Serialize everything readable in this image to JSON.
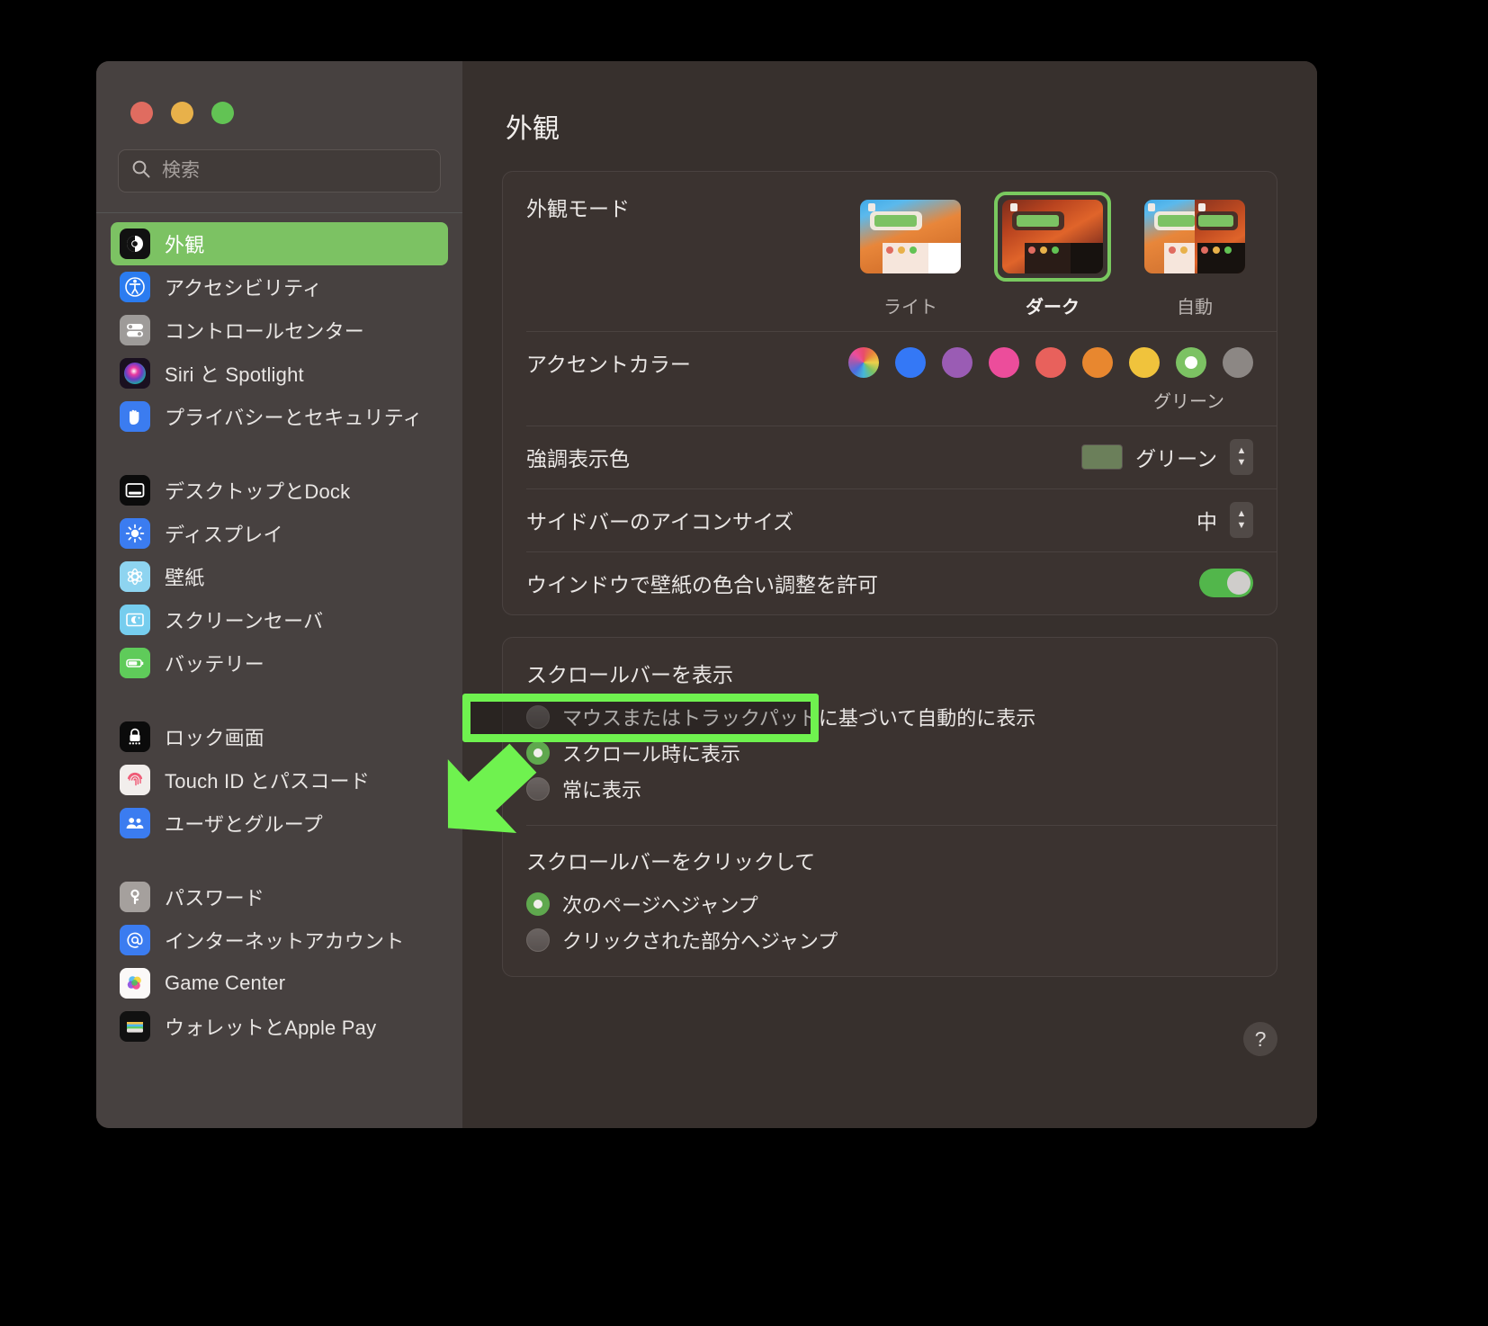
{
  "window": {
    "traffic_lights": [
      "close",
      "minimize",
      "zoom"
    ]
  },
  "sidebar": {
    "search": {
      "placeholder": "検索",
      "value": "",
      "icon": "search-icon"
    },
    "items": [
      {
        "label": "外観",
        "icon": "appearance-icon",
        "selected": true
      },
      {
        "label": "アクセシビリティ",
        "icon": "accessibility-icon",
        "selected": false
      },
      {
        "label": "コントロールセンター",
        "icon": "control-center-icon",
        "selected": false
      },
      {
        "label": "Siri と Spotlight",
        "icon": "siri-icon",
        "selected": false
      },
      {
        "label": "プライバシーとセキュリティ",
        "icon": "privacy-icon",
        "selected": false
      },
      {
        "label": "デスクトップとDock",
        "icon": "desktop-dock-icon",
        "selected": false
      },
      {
        "label": "ディスプレイ",
        "icon": "display-icon",
        "selected": false
      },
      {
        "label": "壁紙",
        "icon": "wallpaper-icon",
        "selected": false
      },
      {
        "label": "スクリーンセーバ",
        "icon": "screensaver-icon",
        "selected": false
      },
      {
        "label": "バッテリー",
        "icon": "battery-icon",
        "selected": false
      },
      {
        "label": "ロック画面",
        "icon": "lock-screen-icon",
        "selected": false
      },
      {
        "label": "Touch ID とパスコード",
        "icon": "touch-id-icon",
        "selected": false
      },
      {
        "label": "ユーザとグループ",
        "icon": "users-groups-icon",
        "selected": false
      },
      {
        "label": "パスワード",
        "icon": "passwords-icon",
        "selected": false
      },
      {
        "label": "インターネットアカウント",
        "icon": "internet-accounts-icon",
        "selected": false
      },
      {
        "label": "Game Center",
        "icon": "game-center-icon",
        "selected": false
      },
      {
        "label": "ウォレットとApple Pay",
        "icon": "wallet-icon",
        "selected": false
      }
    ]
  },
  "main": {
    "title": "外観",
    "appearance_mode": {
      "label": "外観モード",
      "options": [
        {
          "label": "ライト",
          "selected": false
        },
        {
          "label": "ダーク",
          "selected": true
        },
        {
          "label": "自動",
          "selected": false
        }
      ]
    },
    "accent_color": {
      "label": "アクセントカラー",
      "selected_name": "グリーン",
      "swatches": [
        {
          "name": "multicolor",
          "color": "multicolor",
          "selected": false
        },
        {
          "name": "blue",
          "color": "#3478f6",
          "selected": false
        },
        {
          "name": "purple",
          "color": "#9a5cb4",
          "selected": false
        },
        {
          "name": "pink",
          "color": "#ec4d9b",
          "selected": false
        },
        {
          "name": "red",
          "color": "#e8615c",
          "selected": false
        },
        {
          "name": "orange",
          "color": "#e8872f",
          "selected": false
        },
        {
          "name": "yellow",
          "color": "#f0c33c",
          "selected": false
        },
        {
          "name": "green",
          "color": "#7cc263",
          "selected": true
        },
        {
          "name": "graphite",
          "color": "#8c8784",
          "selected": false
        }
      ]
    },
    "highlight_color": {
      "label": "強調表示色",
      "value": "グリーン",
      "chip_color": "#6b7f5a"
    },
    "sidebar_icon_size": {
      "label": "サイドバーのアイコンサイズ",
      "value": "中"
    },
    "allow_wallpaper_tinting": {
      "label": "ウインドウで壁紙の色合い調整を許可",
      "enabled": true
    },
    "show_scroll_bars": {
      "title": "スクロールバーを表示",
      "options": [
        {
          "label": "マウスまたはトラックパッドに基づいて自動的に表示",
          "selected": false
        },
        {
          "label": "スクロール時に表示",
          "selected": true
        },
        {
          "label": "常に表示",
          "selected": false
        }
      ]
    },
    "click_scroll_bar": {
      "title": "スクロールバーをクリックして",
      "options": [
        {
          "label": "次のページへジャンプ",
          "selected": true
        },
        {
          "label": "クリックされた部分へジャンプ",
          "selected": false
        }
      ]
    },
    "help_button": {
      "label": "?"
    }
  },
  "annotations": {
    "highlight_rect": {
      "target": "スクロール時に表示",
      "color": "#6ff24f"
    },
    "arrow": {
      "color": "#6ff24f",
      "direction": "up-right"
    }
  },
  "colors": {
    "accent": "#7cc263",
    "annotation": "#6ff24f",
    "window_bg": "#37302d",
    "sidebar_bg": "#474140"
  }
}
